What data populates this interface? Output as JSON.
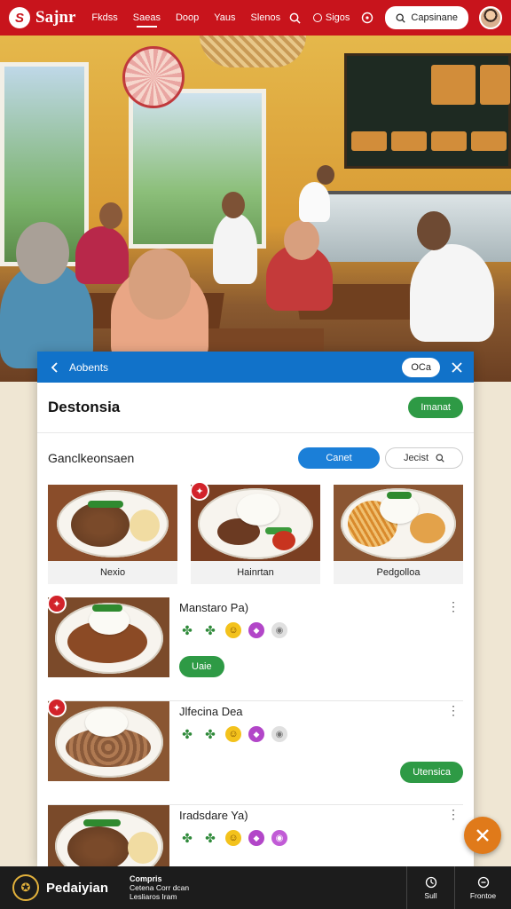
{
  "nav": {
    "logo_text": "Sajnr",
    "links": [
      "Fkdss",
      "Saeas",
      "Doop",
      "Yaus",
      "Slenos"
    ],
    "active_link": 1,
    "filter_label": "Sigos",
    "search_label": "Capsinane"
  },
  "card": {
    "bar_title": "Aobents",
    "bar_chip": "OCa",
    "title": "Destonsia",
    "title_button": "Imanat",
    "section_label": "Ganclkeonsaen",
    "seg_on": "Canet",
    "seg_off": "Jecist",
    "tiles": [
      {
        "caption": "Nexio"
      },
      {
        "caption": "Hainrtan"
      },
      {
        "caption": "Pedgolloa"
      }
    ],
    "items": [
      {
        "title": "Manstaro Pa)",
        "button": "Uaie"
      },
      {
        "title": "Jlfecina Dea",
        "button": "Utensica"
      },
      {
        "title": "Iradsdare Ya)",
        "button": ""
      }
    ]
  },
  "bottom": {
    "brand": "Pedaiyian",
    "info_title": "Compris",
    "info_line1": "Cetena Corr dcan",
    "info_line2": "Lesliaros Iram",
    "action1": "Sull",
    "action2": "Frontoe"
  },
  "colors": {
    "nav_bg": "#c8141c",
    "bar_bg": "#1172c9",
    "accent_green": "#2e9a45",
    "fab": "#e07a1a"
  }
}
